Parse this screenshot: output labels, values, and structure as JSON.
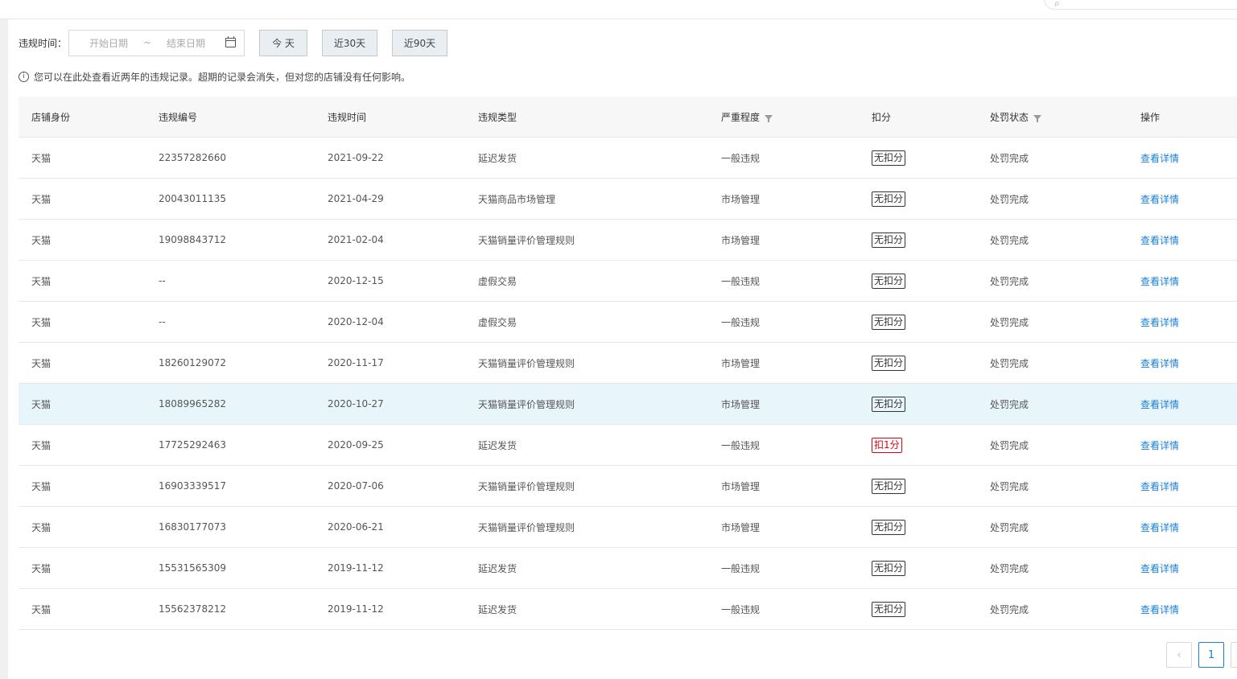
{
  "filter": {
    "label": "违规时间：",
    "start_placeholder": "开始日期",
    "separator": "~",
    "end_placeholder": "结束日期",
    "quick_buttons": [
      "今 天",
      "近30天",
      "近90天"
    ]
  },
  "notice": {
    "icon": "i",
    "text": "您可以在此处查看近两年的违规记录。超期的记录会消失，但对您的店铺没有任何影响。"
  },
  "table": {
    "headers": [
      "店铺身份",
      "违规编号",
      "违规时间",
      "违规类型",
      "严重程度",
      "扣分",
      "处罚状态",
      "操作"
    ],
    "rows": [
      {
        "shop": "天猫",
        "id": "22357282660",
        "date": "2021-09-22",
        "type": "延迟发货",
        "severity": "一般违规",
        "points": "无扣分",
        "status": "处罚完成",
        "action": "查看详情"
      },
      {
        "shop": "天猫",
        "id": "20043011135",
        "date": "2021-04-29",
        "type": "天猫商品市场管理",
        "severity": "市场管理",
        "points": "无扣分",
        "status": "处罚完成",
        "action": "查看详情"
      },
      {
        "shop": "天猫",
        "id": "19098843712",
        "date": "2021-02-04",
        "type": "天猫销量评价管理规则",
        "severity": "市场管理",
        "points": "无扣分",
        "status": "处罚完成",
        "action": "查看详情"
      },
      {
        "shop": "天猫",
        "id": "--",
        "date": "2020-12-15",
        "type": "虚假交易",
        "severity": "一般违规",
        "points": "无扣分",
        "status": "处罚完成",
        "action": "查看详情"
      },
      {
        "shop": "天猫",
        "id": "--",
        "date": "2020-12-04",
        "type": "虚假交易",
        "severity": "一般违规",
        "points": "无扣分",
        "status": "处罚完成",
        "action": "查看详情"
      },
      {
        "shop": "天猫",
        "id": "18260129072",
        "date": "2020-11-17",
        "type": "天猫销量评价管理规则",
        "severity": "市场管理",
        "points": "无扣分",
        "status": "处罚完成",
        "action": "查看详情"
      },
      {
        "shop": "天猫",
        "id": "18089965282",
        "date": "2020-10-27",
        "type": "天猫销量评价管理规则",
        "severity": "市场管理",
        "points": "无扣分",
        "status": "处罚完成",
        "action": "查看详情"
      },
      {
        "shop": "天猫",
        "id": "17725292463",
        "date": "2020-09-25",
        "type": "延迟发货",
        "severity": "一般违规",
        "points": "扣1分",
        "status": "处罚完成",
        "action": "查看详情"
      },
      {
        "shop": "天猫",
        "id": "16903339517",
        "date": "2020-07-06",
        "type": "天猫销量评价管理规则",
        "severity": "市场管理",
        "points": "无扣分",
        "status": "处罚完成",
        "action": "查看详情"
      },
      {
        "shop": "天猫",
        "id": "16830177073",
        "date": "2020-06-21",
        "type": "天猫销量评价管理规则",
        "severity": "市场管理",
        "points": "无扣分",
        "status": "处罚完成",
        "action": "查看详情"
      },
      {
        "shop": "天猫",
        "id": "15531565309",
        "date": "2019-11-12",
        "type": "延迟发货",
        "severity": "一般违规",
        "points": "无扣分",
        "status": "处罚完成",
        "action": "查看详情"
      },
      {
        "shop": "天猫",
        "id": "15562378212",
        "date": "2019-11-12",
        "type": "延迟发货",
        "severity": "一般违规",
        "points": "无扣分",
        "status": "处罚完成",
        "action": "查看详情"
      }
    ]
  },
  "pagination": {
    "prev_icon": "‹",
    "current_page": "1"
  },
  "colors": {
    "link": "#1a7fd6",
    "deduction_red": "#e0000f",
    "row_highlight": "#e8f6fc",
    "header_bg": "#f7f7f7"
  }
}
